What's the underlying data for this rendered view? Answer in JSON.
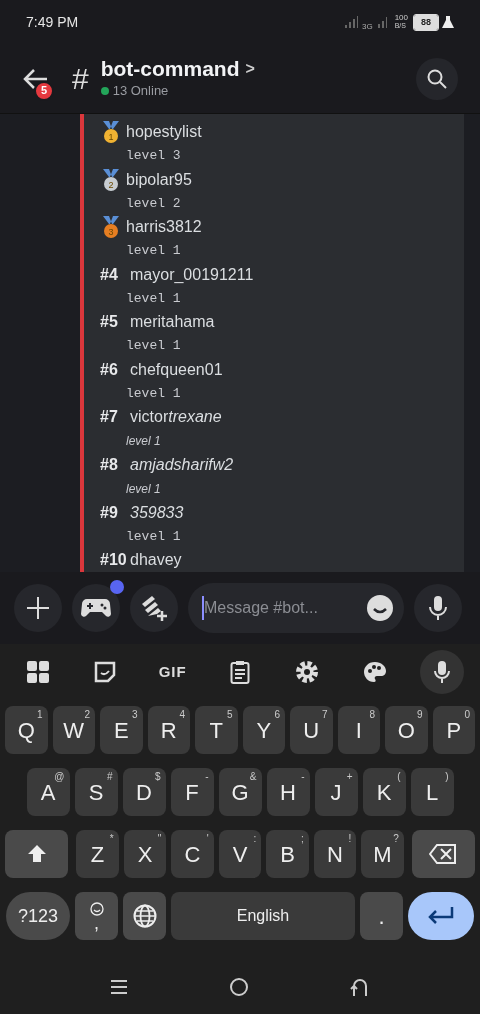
{
  "status_bar": {
    "time": "7:49 PM",
    "network": "3G",
    "speed_value": "100",
    "speed_unit": "B/S",
    "battery": "88"
  },
  "header": {
    "back_badge": "5",
    "channel_icon": "#",
    "channel": "bot-command",
    "chevron": ">",
    "online": "13 Online"
  },
  "leaderboard": [
    {
      "kind": "medal",
      "color": "#f0b232",
      "medal_number": "1",
      "name": "hopestylist",
      "name_italic": false,
      "level": "level 3",
      "level_italic": false
    },
    {
      "kind": "medal",
      "color": "#c7ccd1",
      "medal_number": "2",
      "name": "bipolar95",
      "name_italic": false,
      "level": "level 2",
      "level_italic": false
    },
    {
      "kind": "medal",
      "color": "#e67e22",
      "medal_number": "3",
      "name": "harris3812",
      "name_italic": false,
      "level": "level 1",
      "level_italic": false
    },
    {
      "kind": "rank",
      "rank": "#4",
      "name": "mayor_00191211",
      "name_italic": false,
      "level": "level 1",
      "level_italic": false
    },
    {
      "kind": "rank",
      "rank": "#5",
      "name": "meritahama",
      "name_italic": false,
      "level": "level 1",
      "level_italic": false
    },
    {
      "kind": "rank",
      "rank": "#6",
      "name": "chefqueen01",
      "name_italic": false,
      "level": "level 1",
      "level_italic": false
    },
    {
      "kind": "rank",
      "rank": "#7",
      "name": "victor",
      "name_italic": false,
      "name_italic_part": "trexane",
      "level": "level 1",
      "level_italic": true
    },
    {
      "kind": "rank",
      "rank": "#8",
      "name": "amjadsharifw2",
      "name_italic": true,
      "level": "level 1",
      "level_italic": true
    },
    {
      "kind": "rank",
      "rank": "#9",
      "name": "359833",
      "name_italic": true,
      "level": "level 1",
      "level_italic": false
    },
    {
      "kind": "rank",
      "rank": "#10",
      "name": "dhavey",
      "name_italic": false
    }
  ],
  "composer": {
    "placeholder": "Message #bot...",
    "activity_dot": true
  },
  "keyboard_toolbar": {
    "gif": "GIF"
  },
  "keyboard": {
    "rows": [
      [
        {
          "key": "Q",
          "hint": "1"
        },
        {
          "key": "W",
          "hint": "2"
        },
        {
          "key": "E",
          "hint": "3"
        },
        {
          "key": "R",
          "hint": "4"
        },
        {
          "key": "T",
          "hint": "5"
        },
        {
          "key": "Y",
          "hint": "6"
        },
        {
          "key": "U",
          "hint": "7"
        },
        {
          "key": "I",
          "hint": "8"
        },
        {
          "key": "O",
          "hint": "9"
        },
        {
          "key": "P",
          "hint": "0"
        }
      ],
      [
        {
          "key": "A",
          "hint": "@"
        },
        {
          "key": "S",
          "hint": "#"
        },
        {
          "key": "D",
          "hint": "$"
        },
        {
          "key": "F",
          "hint": "-"
        },
        {
          "key": "G",
          "hint": "&"
        },
        {
          "key": "H",
          "hint": "-"
        },
        {
          "key": "J",
          "hint": "+"
        },
        {
          "key": "K",
          "hint": "("
        },
        {
          "key": "L",
          "hint": ")"
        }
      ],
      [
        {
          "key": "Z",
          "hint": "*"
        },
        {
          "key": "X",
          "hint": "\""
        },
        {
          "key": "C",
          "hint": "'"
        },
        {
          "key": "V",
          "hint": ":"
        },
        {
          "key": "B",
          "hint": ";"
        },
        {
          "key": "N",
          "hint": "!"
        },
        {
          "key": "M",
          "hint": "?"
        }
      ]
    ],
    "symbols": "?123",
    "emoji_comma": ",",
    "space": "English",
    "period": "."
  }
}
